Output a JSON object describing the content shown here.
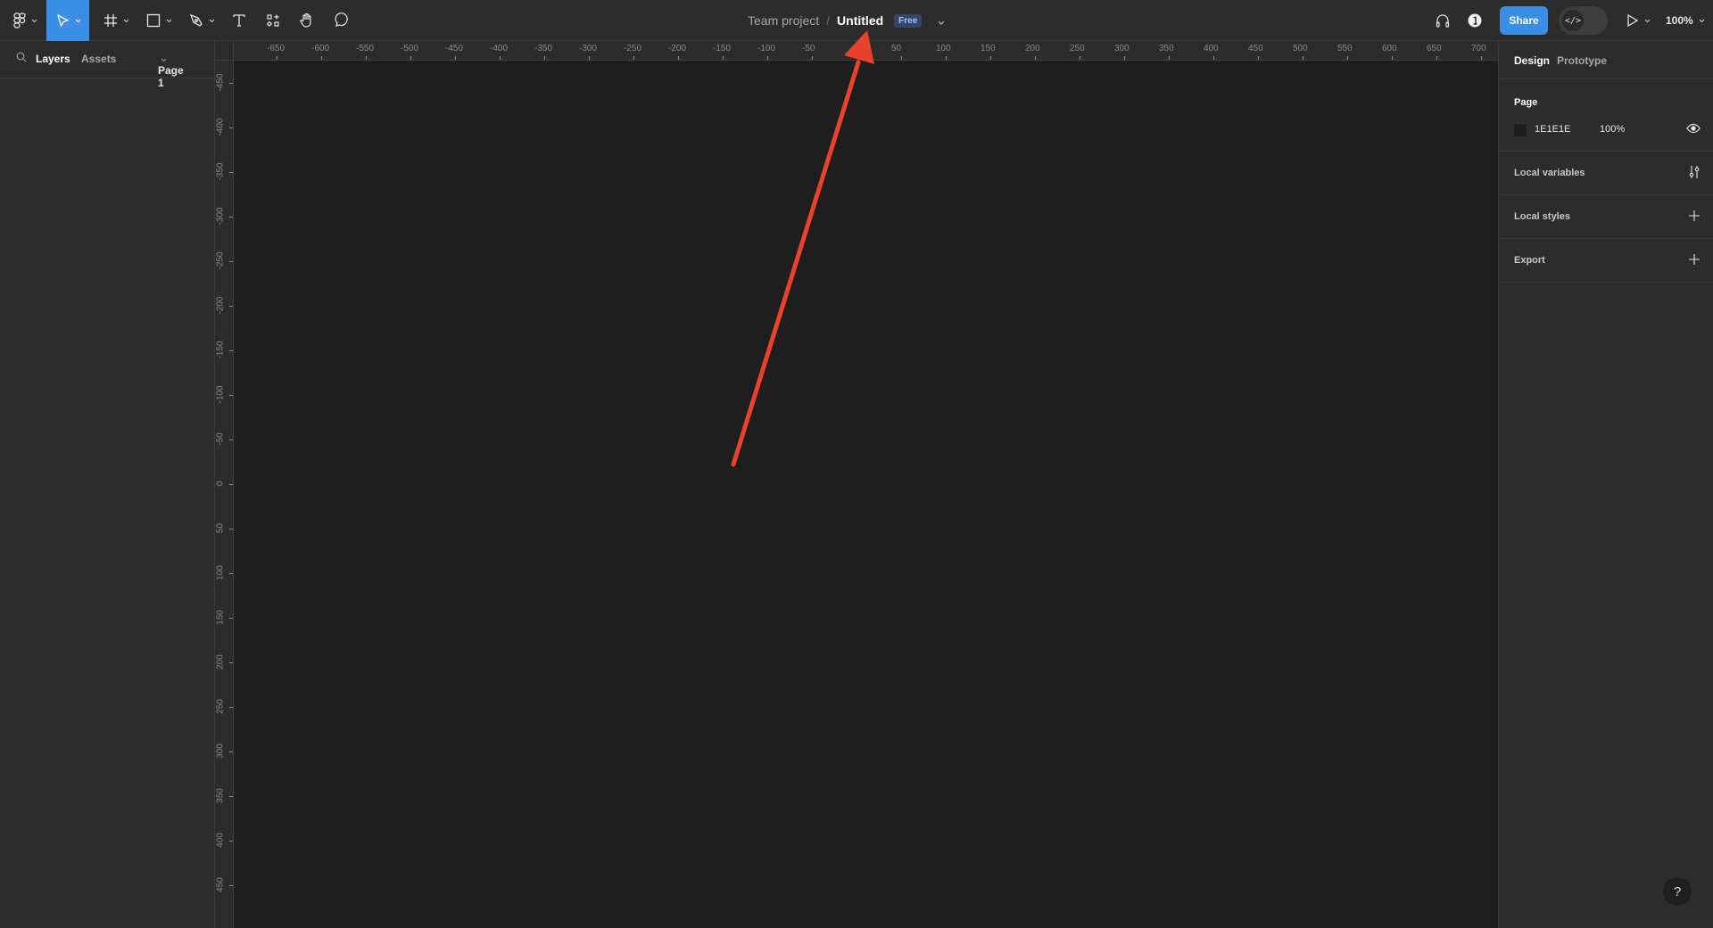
{
  "toolbar": {
    "tools": [
      {
        "name": "main-menu",
        "icon": "figma-logo-icon"
      },
      {
        "name": "move-tool",
        "icon": "cursor-icon",
        "active": true
      },
      {
        "name": "frame-tool",
        "icon": "frame-icon"
      },
      {
        "name": "shape-tool",
        "icon": "rectangle-icon"
      },
      {
        "name": "pen-tool",
        "icon": "pen-icon"
      },
      {
        "name": "text-tool",
        "icon": "text-icon"
      },
      {
        "name": "resources-tool",
        "icon": "components-icon"
      },
      {
        "name": "hand-tool",
        "icon": "hand-icon"
      },
      {
        "name": "comment-tool",
        "icon": "comment-icon"
      }
    ],
    "project": "Team project",
    "separator": "/",
    "file_name": "Untitled",
    "plan_badge": "Free",
    "share_label": "Share",
    "dev_mode_label": "</>",
    "zoom_level": "100%",
    "accent_color": "#3a8ee6"
  },
  "left_panel": {
    "tabs": [
      "Layers",
      "Assets"
    ],
    "active_tab": "Layers",
    "page_selector": "Page 1"
  },
  "rulers": {
    "horizontal": [
      "-650",
      "-600",
      "-550",
      "-500",
      "-450",
      "-400",
      "-350",
      "-300",
      "-250",
      "-200",
      "-150",
      "-100",
      "-50",
      "50",
      "100",
      "150",
      "200",
      "250",
      "300",
      "350",
      "400",
      "450",
      "500",
      "550",
      "600",
      "650",
      "700"
    ],
    "vertical": [
      "-450",
      "-400",
      "-350",
      "-300",
      "-250",
      "-200",
      "-150",
      "-100",
      "-50",
      "0",
      "50",
      "100",
      "150",
      "200",
      "250",
      "300",
      "350",
      "400",
      "450"
    ]
  },
  "right_panel": {
    "tabs": [
      "Design",
      "Prototype"
    ],
    "active_tab": "Design",
    "page_section": {
      "title": "Page",
      "color_hex": "1E1E1E",
      "opacity": "100%",
      "swatch_color": "#1e1e1e"
    },
    "sections": [
      {
        "label": "Local variables",
        "icon": "variables-icon"
      },
      {
        "label": "Local styles",
        "icon": "plus-icon"
      },
      {
        "label": "Export",
        "icon": "plus-icon"
      }
    ]
  },
  "help_label": "?",
  "annotation": {
    "color": "#e8412c",
    "points_to": "file-name"
  }
}
